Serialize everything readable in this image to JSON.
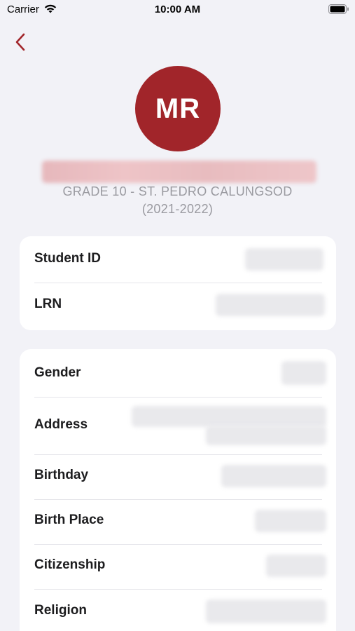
{
  "status_bar": {
    "carrier": "Carrier",
    "time": "10:00 AM",
    "icons": [
      "wifi-icon",
      "battery-icon"
    ]
  },
  "nav": {
    "back_icon": "chevron-left-icon",
    "accent_color": "#a1252a"
  },
  "profile": {
    "initials": "MR",
    "avatar_color": "#a1252a",
    "grade_line": "GRADE 10 - ST. PEDRO CALUNGSOD",
    "school_year": "(2021-2022)"
  },
  "ids_card": {
    "rows": [
      {
        "label": "Student ID"
      },
      {
        "label": "LRN"
      }
    ]
  },
  "info_card": {
    "rows": [
      {
        "label": "Gender"
      },
      {
        "label": "Address"
      },
      {
        "label": "Birthday"
      },
      {
        "label": "Birth Place"
      },
      {
        "label": "Citizenship"
      },
      {
        "label": "Religion"
      }
    ]
  }
}
